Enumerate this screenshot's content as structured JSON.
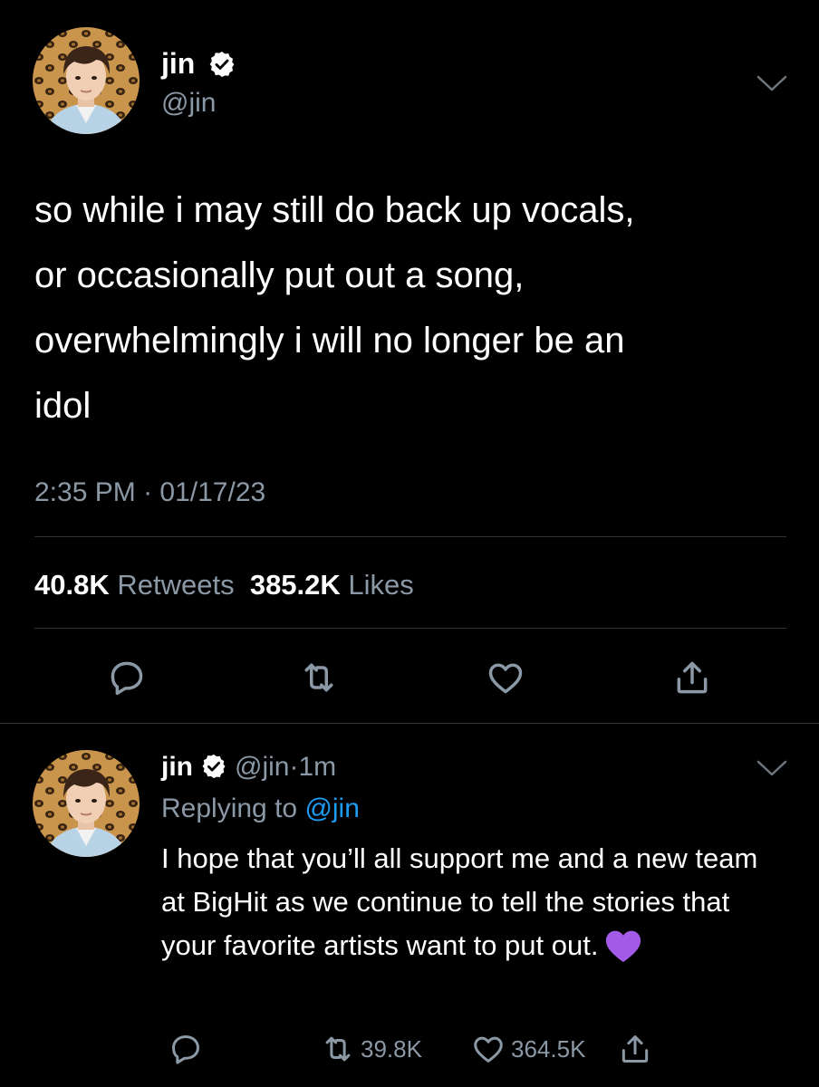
{
  "main_tweet": {
    "display_name": "jin",
    "handle": "@jin",
    "text": "so while i may still do back up vocals,\nor occasionally put out a song,\noverwhelmingly i will no longer be an\nidol",
    "time": "2:35 PM",
    "separator_dot": "·",
    "date": "01/17/23",
    "retweet_count": "40.8K",
    "retweets_label": "Retweets",
    "like_count": "385.2K",
    "likes_label": "Likes",
    "icons": [
      "reply-icon",
      "retweet-icon",
      "like-icon",
      "share-icon"
    ]
  },
  "reply_tweet": {
    "display_name": "jin",
    "handle": "@jin",
    "time_sep": "·",
    "time": "1m",
    "replying_to_label": "Replying to",
    "replying_to_handle": "@jin",
    "text": "I hope that you’ll all support me and a new team at BigHit as we continue to tell the stories that your favorite artists want to put out.",
    "emoji": "purple-heart-emoji",
    "retweet_count": "39.8K",
    "like_count": "364.5K"
  },
  "colors": {
    "background": "#000000",
    "text": "#ffffff",
    "muted": "#8b98a5",
    "link": "#1d9bf0",
    "divider": "#2f3336",
    "emoji_purple": "#a35ae6"
  }
}
